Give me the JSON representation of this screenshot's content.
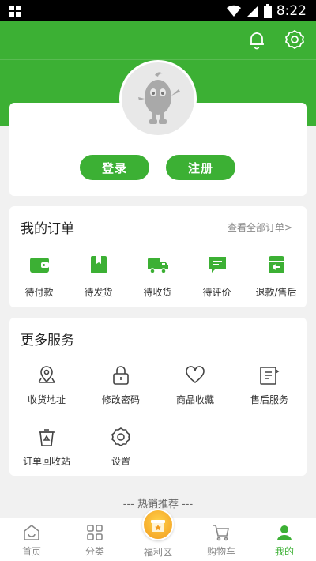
{
  "status_bar": {
    "time": "8:22"
  },
  "header": {
    "icons": [
      "bell-icon",
      "gear-icon"
    ]
  },
  "profile": {
    "login_label": "登录",
    "register_label": "注册"
  },
  "orders": {
    "title": "我的订单",
    "view_all": "查看全部订单>",
    "items": [
      {
        "label": "待付款",
        "icon": "wallet-icon"
      },
      {
        "label": "待发货",
        "icon": "package-icon"
      },
      {
        "label": "待收货",
        "icon": "truck-icon"
      },
      {
        "label": "待评价",
        "icon": "comment-icon"
      },
      {
        "label": "退款/售后",
        "icon": "refund-icon"
      }
    ]
  },
  "services": {
    "title": "更多服务",
    "items": [
      {
        "label": "收货地址",
        "icon": "map-pin-icon"
      },
      {
        "label": "修改密码",
        "icon": "lock-icon"
      },
      {
        "label": "商品收藏",
        "icon": "heart-icon"
      },
      {
        "label": "售后服务",
        "icon": "after-sale-icon"
      },
      {
        "label": "订单回收站",
        "icon": "recycle-bin-icon"
      },
      {
        "label": "设置",
        "icon": "settings-icon"
      }
    ]
  },
  "hot": {
    "title": "--- 热销推荐 ---"
  },
  "bottom_nav": {
    "items": [
      {
        "label": "首页",
        "icon": "home-icon",
        "active": false
      },
      {
        "label": "分类",
        "icon": "category-icon",
        "active": false
      },
      {
        "label": "福利区",
        "icon": "gift-icon",
        "active": false
      },
      {
        "label": "购物车",
        "icon": "cart-icon",
        "active": false
      },
      {
        "label": "我的",
        "icon": "user-icon",
        "active": true
      }
    ]
  },
  "colors": {
    "brand": "#3cb034",
    "background": "#f1f1f1",
    "accent_orange": "#f29b1e"
  }
}
